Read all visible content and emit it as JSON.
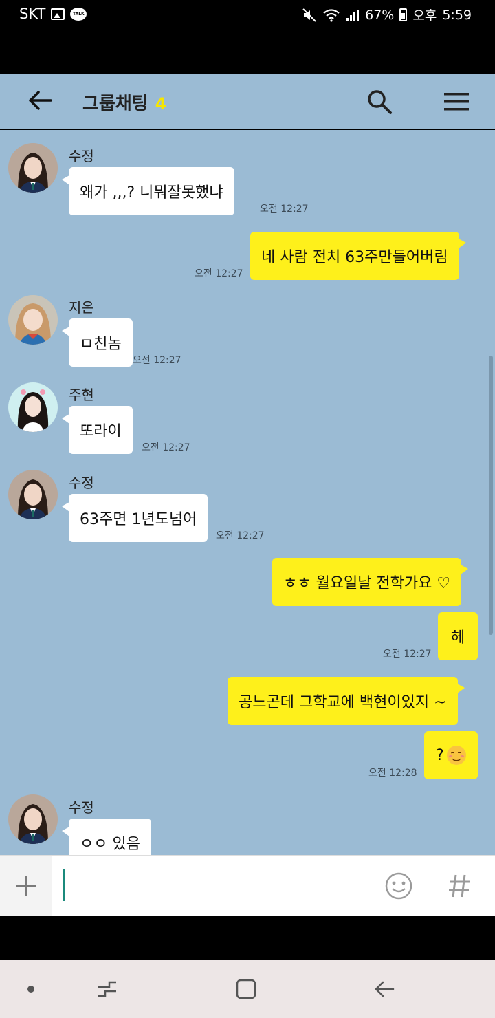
{
  "status_bar": {
    "carrier": "SKT",
    "talk_badge": "TALK",
    "battery": "67%",
    "ampm": "오후",
    "time": "5:59"
  },
  "header": {
    "title": "그룹채팅",
    "member_count": "4"
  },
  "messages": [
    {
      "sender": "수정",
      "text": "왜가 ,,,?  니뭐잘못했냐",
      "time": "오전 12:27"
    },
    {
      "text": "네 사람  전치 63주만들어버림",
      "time": "오전 12:27"
    },
    {
      "sender": "지은",
      "text": "ㅁ친놈",
      "time": "오전 12:27"
    },
    {
      "sender": "주현",
      "text": "또라이",
      "time": "오전 12:27"
    },
    {
      "sender": "수정",
      "text": "63주면 1년도넘어",
      "time": "오전 12:27"
    },
    {
      "text": "ㅎㅎ 월요일날 전학가요 ♡",
      "time": ""
    },
    {
      "text": "헤",
      "time": "오전 12:27"
    },
    {
      "text": "공느곤데 그학교에 백현이있지 ~",
      "time": ""
    },
    {
      "text": "?",
      "emoji": "smiling-face-emoji",
      "time": "오전 12:28"
    },
    {
      "sender": "수정",
      "text": "ㅇㅇ 있음",
      "time": ""
    }
  ],
  "input": {
    "placeholder": ""
  },
  "icons": {
    "back": "arrow-left-icon",
    "search": "search-icon",
    "menu": "hamburger-menu-icon",
    "plus": "plus-icon",
    "emoticon": "emoticon-icon",
    "hash": "hash-icon"
  },
  "colors": {
    "chat_background": "#9bbbd4",
    "outgoing_bubble": "#fef01b",
    "incoming_bubble": "#ffffff",
    "member_count": "#f7e600",
    "caret": "#1b8a7c"
  }
}
